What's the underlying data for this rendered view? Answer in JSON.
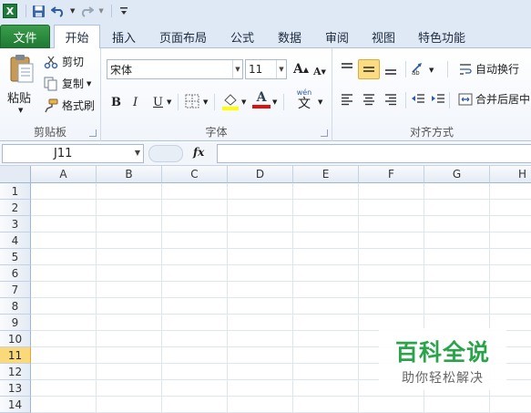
{
  "qat": {
    "app_icon": "X",
    "icons": [
      "excel-logo-icon",
      "save-icon",
      "undo-icon",
      "redo-icon",
      "customize-qat-icon"
    ]
  },
  "tabs": {
    "file": "文件",
    "items": [
      "开始",
      "插入",
      "页面布局",
      "公式",
      "数据",
      "审阅",
      "视图",
      "特色功能"
    ],
    "active": "开始"
  },
  "ribbon": {
    "clipboard": {
      "label": "剪贴板",
      "paste": "粘贴",
      "cut": "剪切",
      "copy": "复制",
      "format_painter": "格式刷"
    },
    "font": {
      "label": "字体",
      "name": "宋体",
      "size": "11",
      "bold": "B",
      "italic": "I",
      "underline": "U",
      "grow": "A",
      "shrink": "A",
      "font_color": "A",
      "phonetic": "wén",
      "phonetic_char": "文"
    },
    "alignment": {
      "label": "对齐方式",
      "wrap": "自动换行",
      "merge": "合并后居中"
    }
  },
  "formula_bar": {
    "name_box": "J11",
    "fx": "fx",
    "formula": ""
  },
  "sheet": {
    "columns": [
      "A",
      "B",
      "C",
      "D",
      "E",
      "F",
      "G",
      "H"
    ],
    "rows": [
      "1",
      "2",
      "3",
      "4",
      "5",
      "6",
      "7",
      "8",
      "9",
      "10",
      "11",
      "12",
      "13",
      "14"
    ],
    "selected_row": "11"
  },
  "watermark": {
    "title": "百科全说",
    "subtitle": "助你轻松解决"
  },
  "colors": {
    "file_tab": "#2b8a3e",
    "selected_row_header": "#f9d97a",
    "accent": "#1f7a3c",
    "watermark_green": "#2aa44a"
  }
}
